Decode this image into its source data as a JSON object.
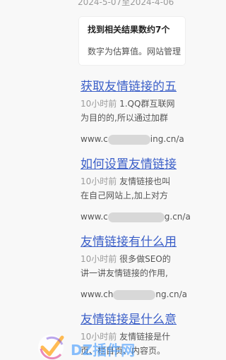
{
  "top": {
    "date_text": "2024-5-07至2024-4-06"
  },
  "notice": {
    "title": "找到相关结果数约7个",
    "subtitle": "数字为估算值。网站管理"
  },
  "results": [
    {
      "title": "获取友情链接的五",
      "snippet1": "1.QQ群互联网",
      "snippet2": "为目的的,所以通过加群",
      "time": "10小时前",
      "url_prefix": "www.c",
      "url_suffix": "ing.cn/a"
    },
    {
      "title": "如何设置友情链接",
      "snippet1": "友情链接也叫",
      "snippet2": "在自己网站上,加上对方",
      "time": "10小时前",
      "url_prefix": "www.c",
      "url_suffix": "g.cn/a"
    },
    {
      "title": "友情链接有什么用",
      "snippet1": "很多做SEO的",
      "snippet2": "讲一讲友情链接的作用,",
      "time": "10小时前",
      "url_prefix": "www.ch",
      "url_suffix": "ng.cn/a"
    },
    {
      "title": "友情链接是什么意",
      "snippet1": "友情链接是什",
      "snippet2": "页、栏目页、内容页。",
      "time": "10小时前"
    }
  ],
  "watermark": {
    "text": "DZ插件网"
  }
}
